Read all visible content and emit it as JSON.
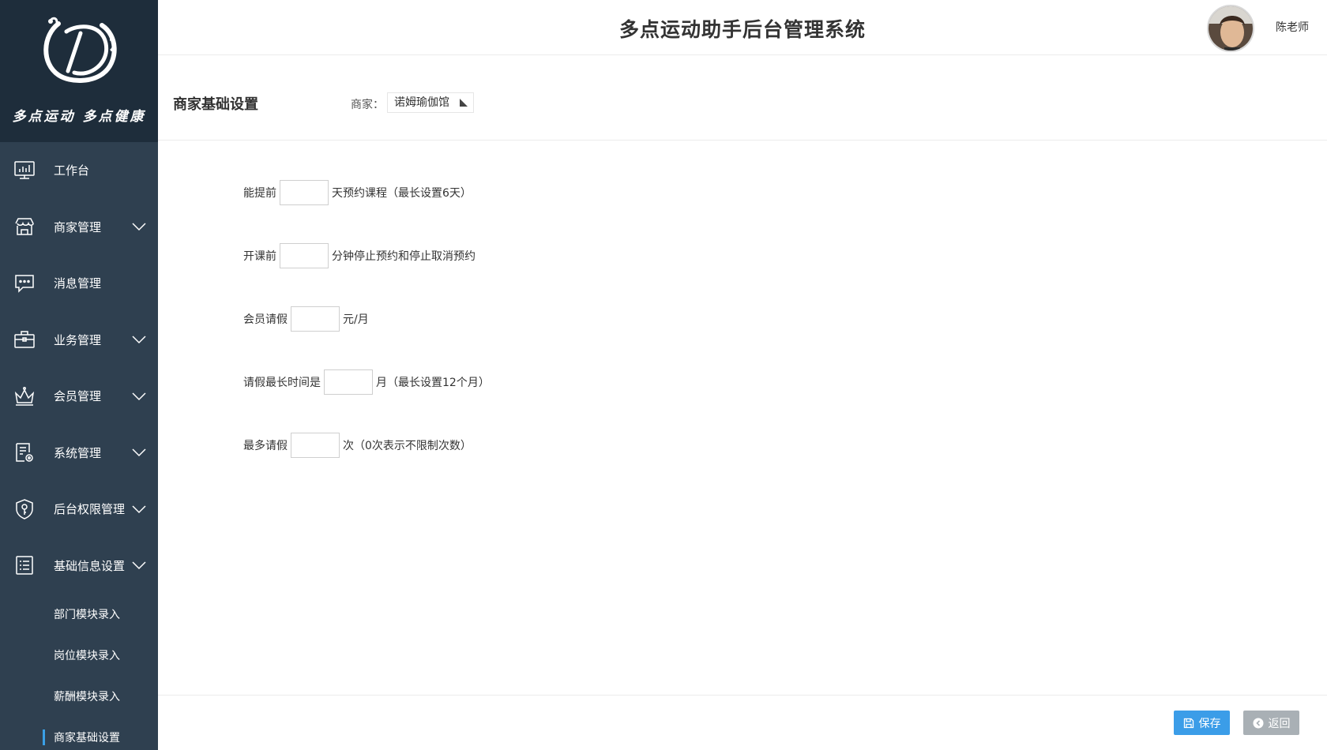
{
  "header": {
    "app_title": "多点运动助手后台管理系统",
    "username": "陈老师"
  },
  "logo": {
    "slogan": "多点运动 多点健康"
  },
  "sidebar": {
    "items": [
      {
        "label": "工作台",
        "icon": "dashboard-icon",
        "expandable": false
      },
      {
        "label": "商家管理",
        "icon": "store-icon",
        "expandable": true
      },
      {
        "label": "消息管理",
        "icon": "message-icon",
        "expandable": false
      },
      {
        "label": "业务管理",
        "icon": "briefcase-icon",
        "expandable": true
      },
      {
        "label": "会员管理",
        "icon": "crown-icon",
        "expandable": true
      },
      {
        "label": "系统管理",
        "icon": "system-settings-icon",
        "expandable": true
      },
      {
        "label": "后台权限管理",
        "icon": "permission-key-icon",
        "expandable": true
      },
      {
        "label": "基础信息设置",
        "icon": "list-icon",
        "expandable": true
      }
    ],
    "sub_items": [
      {
        "label": "部门模块录入"
      },
      {
        "label": "岗位模块录入"
      },
      {
        "label": "薪酬模块录入"
      },
      {
        "label": "商家基础设置",
        "active": true
      }
    ]
  },
  "page": {
    "title": "商家基础设置",
    "merchant_label": "商家：",
    "merchant_value": "诺姆瑜伽馆"
  },
  "form": {
    "rows": [
      {
        "prefix": "能提前",
        "value": "",
        "suffix": "天预约课程（最长设置6天）"
      },
      {
        "prefix": "开课前",
        "value": "",
        "suffix": "分钟停止预约和停止取消预约"
      },
      {
        "prefix": "会员请假",
        "value": "",
        "suffix": "元/月"
      },
      {
        "prefix": "请假最长时间是",
        "value": "",
        "suffix": "月（最长设置12个月）"
      },
      {
        "prefix": "最多请假",
        "value": "",
        "suffix": "次（0次表示不限制次数）"
      }
    ]
  },
  "footer": {
    "save_label": "保存",
    "back_label": "返回"
  },
  "colors": {
    "sidebar_bg": "#2f4050",
    "logo_bg": "#1e2d3b",
    "save_button": "#3b9de8",
    "back_button": "#a9b0b5",
    "active_marker": "#3aa0e6"
  }
}
